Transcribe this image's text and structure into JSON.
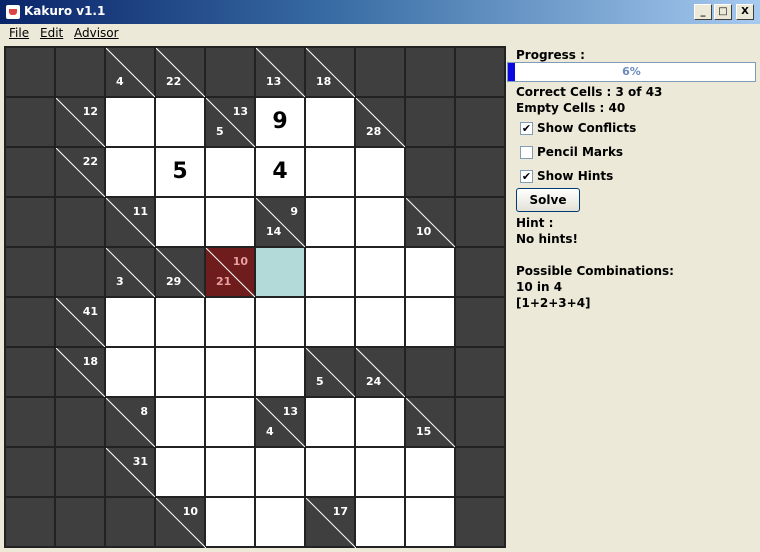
{
  "window": {
    "title": "Kakuro v1.1",
    "buttons": [
      "_",
      "□",
      "X"
    ]
  },
  "menu": [
    "File",
    "Edit",
    "Advisor"
  ],
  "colors": {
    "board_black": "#3F3F3F",
    "highlight": "#B3D9D9",
    "error": "#6E1C1C",
    "progress": "#0A0AE0"
  },
  "board": {
    "rows": [
      [
        {
          "t": "b"
        },
        {
          "t": "b"
        },
        {
          "t": "c",
          "d": "4"
        },
        {
          "t": "c",
          "d": "22"
        },
        {
          "t": "b"
        },
        {
          "t": "c",
          "d": "13"
        },
        {
          "t": "c",
          "d": "18"
        },
        {
          "t": "b"
        },
        {
          "t": "b"
        },
        {
          "t": "b"
        }
      ],
      [
        {
          "t": "b"
        },
        {
          "t": "c",
          "a": "12"
        },
        {
          "t": "w"
        },
        {
          "t": "w"
        },
        {
          "t": "c",
          "d": "5",
          "a": "13"
        },
        {
          "t": "w",
          "v": "9"
        },
        {
          "t": "w"
        },
        {
          "t": "c",
          "d": "28"
        },
        {
          "t": "b"
        },
        {
          "t": "b"
        }
      ],
      [
        {
          "t": "b"
        },
        {
          "t": "c",
          "a": "22"
        },
        {
          "t": "w"
        },
        {
          "t": "w",
          "v": "5"
        },
        {
          "t": "w"
        },
        {
          "t": "w",
          "v": "4"
        },
        {
          "t": "w"
        },
        {
          "t": "w"
        },
        {
          "t": "b"
        },
        {
          "t": "b"
        }
      ],
      [
        {
          "t": "b"
        },
        {
          "t": "b"
        },
        {
          "t": "c",
          "a": "11"
        },
        {
          "t": "w"
        },
        {
          "t": "w"
        },
        {
          "t": "c",
          "d": "14",
          "a": "9"
        },
        {
          "t": "w"
        },
        {
          "t": "w"
        },
        {
          "t": "c",
          "d": "10"
        },
        {
          "t": "b"
        }
      ],
      [
        {
          "t": "b"
        },
        {
          "t": "b"
        },
        {
          "t": "c",
          "d": "3"
        },
        {
          "t": "c",
          "d": "29"
        },
        {
          "t": "e",
          "d": "21",
          "a": "10"
        },
        {
          "t": "h"
        },
        {
          "t": "w"
        },
        {
          "t": "w"
        },
        {
          "t": "w"
        },
        {
          "t": "b"
        }
      ],
      [
        {
          "t": "b"
        },
        {
          "t": "c",
          "a": "41"
        },
        {
          "t": "w"
        },
        {
          "t": "w"
        },
        {
          "t": "w"
        },
        {
          "t": "w"
        },
        {
          "t": "w"
        },
        {
          "t": "w"
        },
        {
          "t": "w"
        },
        {
          "t": "b"
        }
      ],
      [
        {
          "t": "b"
        },
        {
          "t": "c",
          "a": "18"
        },
        {
          "t": "w"
        },
        {
          "t": "w"
        },
        {
          "t": "w"
        },
        {
          "t": "w"
        },
        {
          "t": "c",
          "d": "5"
        },
        {
          "t": "c",
          "d": "24"
        },
        {
          "t": "b"
        },
        {
          "t": "b"
        }
      ],
      [
        {
          "t": "b"
        },
        {
          "t": "b"
        },
        {
          "t": "c",
          "a": "8"
        },
        {
          "t": "w"
        },
        {
          "t": "w"
        },
        {
          "t": "c",
          "d": "4",
          "a": "13"
        },
        {
          "t": "w"
        },
        {
          "t": "w"
        },
        {
          "t": "c",
          "d": "15"
        },
        {
          "t": "b"
        }
      ],
      [
        {
          "t": "b"
        },
        {
          "t": "b"
        },
        {
          "t": "c",
          "a": "31"
        },
        {
          "t": "w"
        },
        {
          "t": "w"
        },
        {
          "t": "w"
        },
        {
          "t": "w"
        },
        {
          "t": "w"
        },
        {
          "t": "w"
        },
        {
          "t": "b"
        }
      ],
      [
        {
          "t": "b"
        },
        {
          "t": "b"
        },
        {
          "t": "b"
        },
        {
          "t": "c",
          "a": "10"
        },
        {
          "t": "w"
        },
        {
          "t": "w"
        },
        {
          "t": "c",
          "a": "17"
        },
        {
          "t": "w"
        },
        {
          "t": "w"
        },
        {
          "t": "b"
        }
      ]
    ]
  },
  "panel": {
    "progress_label": "Progress :",
    "progress_text": "6%",
    "progress_value": 0.03,
    "correct_cells": "Correct Cells : 3 of 43",
    "empty_cells": "Empty Cells : 40",
    "show_conflicts": {
      "label": "Show Conflicts",
      "checked": true
    },
    "pencil_marks": {
      "label": "Pencil Marks",
      "checked": false
    },
    "show_hints": {
      "label": "Show Hints",
      "checked": true
    },
    "solve_label": "Solve",
    "hint_label": "Hint :",
    "hint_text": "No hints!",
    "combos_label": "Possible Combinations:",
    "combos_line1": "10 in 4",
    "combos_line2": "[1+2+3+4]"
  }
}
